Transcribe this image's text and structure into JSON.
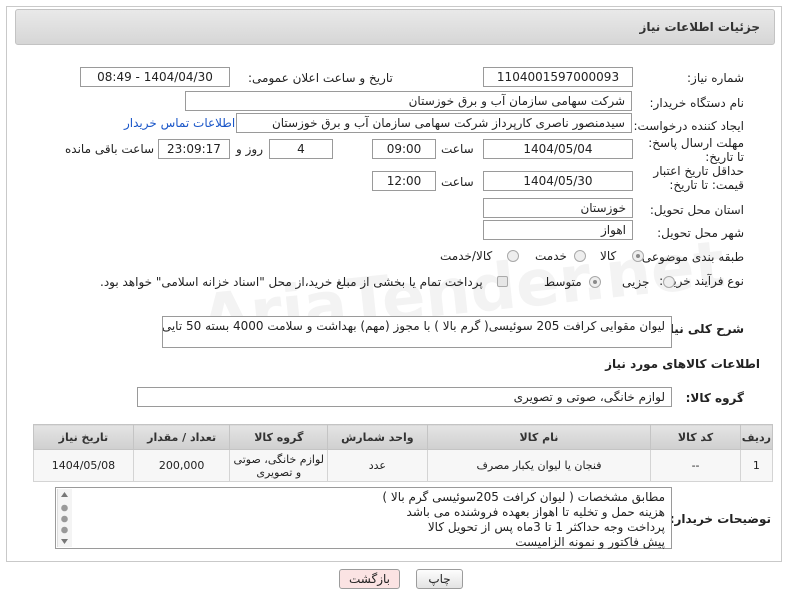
{
  "header": {
    "title": "جزئیات اطلاعات نیاز"
  },
  "fields": {
    "need_number_label": "شماره نیاز:",
    "need_number": "1104001597000093",
    "announce_label": "تاریخ و ساعت اعلان عمومی:",
    "announce_value": "1404/04/30 - 08:49",
    "buyer_org_label": "نام دستگاه خریدار:",
    "buyer_org": "شرکت سهامی سازمان آب و برق خوزستان",
    "creator_label": "ایجاد کننده درخواست:",
    "creator": "سیدمنصور ناصری کارپرداز شرکت سهامی سازمان آب و برق خوزستان",
    "contact_link": "اطلاعات تماس خریدار",
    "deadline_label": "مهلت ارسال پاسخ: تا تاریخ:",
    "deadline_date": "1404/05/04",
    "time_label": "ساعت",
    "deadline_time": "09:00",
    "days_value": "4",
    "days_label": "روز و",
    "remaining_time": "23:09:17",
    "remaining_label": "ساعت باقی مانده",
    "validity_label": "حداقل تاریخ اعتبار قیمت: تا تاریخ:",
    "validity_date": "1404/05/30",
    "validity_time": "12:00",
    "province_label": "استان محل تحویل:",
    "province": "خوزستان",
    "city_label": "شهر محل تحویل:",
    "city": "اهواز",
    "category_label": "طبقه بندی موضوعی:",
    "category_options": [
      "کالا",
      "خدمت",
      "کالا/خدمت"
    ],
    "process_label": "نوع فرآیند خرید :",
    "process_options": [
      "جزیی",
      "متوسط"
    ],
    "treasury_note": "پرداخت تمام یا بخشی از مبلغ خرید،از محل \"اسناد خزانه اسلامی\" خواهد بود.",
    "general_desc_label": "شرح کلی نیاز:",
    "general_desc": "لیوان  مقوایی کرافت 205 سوئیسی( گرم بالا ) با مجوز (مهم) بهداشت و سلامت 4000 بسته 50 تایی",
    "goods_info_title": "اطلاعات کالاهای مورد نیاز",
    "goods_group_label": "گروه کالا:",
    "goods_group": "لوازم خانگی، صوتی و تصویری"
  },
  "table": {
    "headers": [
      "ردیف",
      "کد کالا",
      "نام کالا",
      "واحد شمارش",
      "گروه کالا",
      "تعداد / مقدار",
      "تاریخ نیاز"
    ],
    "rows": [
      [
        "1",
        "--",
        "فنجان یا لیوان یکبار مصرف",
        "عدد",
        "لوازم خانگی، صوتی و تصویری",
        "200,000",
        "1404/05/08"
      ]
    ]
  },
  "notes": {
    "label": "توضیحات خریدار:",
    "lines": [
      "مطابق مشخصات ( لیوان کرافت 205سوئیسی گرم بالا )",
      "هزینه حمل و تخلیه تا اهواز بعهده فروشنده می باشد",
      "پرداخت وجه حداکثر 1 تا 3ماه پس از تحویل کالا",
      "پیش فاکتور و نمونه الزامیست"
    ]
  },
  "buttons": {
    "print": "چاپ",
    "back": "بازگشت"
  },
  "watermark": "AriaTender.net",
  "colors": {
    "link": "#1a56c8",
    "back_button": "#fbe3e3"
  }
}
